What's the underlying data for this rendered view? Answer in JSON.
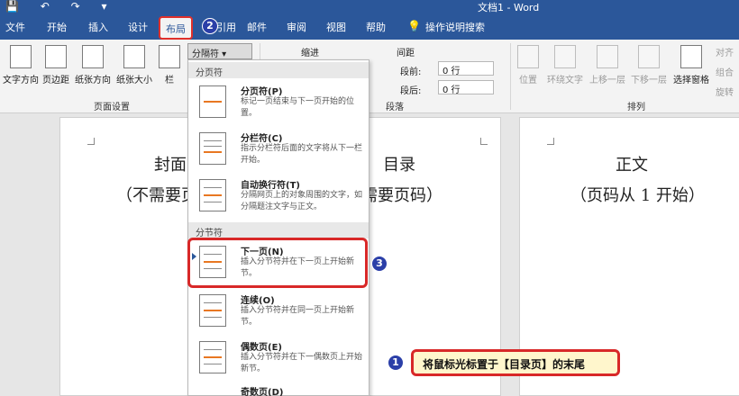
{
  "titlebar": {
    "quick_access": "💾 ↶ ↷ ▾",
    "doc_title": "文档1 - Word"
  },
  "tabs": [
    "文件",
    "开始",
    "插入",
    "设计",
    "布局",
    "引用",
    "邮件",
    "审阅",
    "视图",
    "帮助",
    "操作说明搜索"
  ],
  "ribbon": {
    "buttons": [
      "文字方向",
      "页边距",
      "纸张方向",
      "纸张大小",
      "栏"
    ],
    "breaks_label": "分隔符 ▾",
    "indent_label": "缩进",
    "spacing_label": "间距",
    "before_label": "段前:",
    "after_label": "段后:",
    "before_value": "0 行",
    "after_value": "0 行",
    "arrange_buttons": [
      "位置",
      "环绕文字",
      "上移一层",
      "下移一层",
      "选择窗格"
    ],
    "align_labels": [
      "对齐",
      "组合",
      "旋转"
    ],
    "groups": {
      "page_setup": "页面设置",
      "paragraph": "段落",
      "arrange": "排列"
    }
  },
  "pages": {
    "cover_line1": "封面",
    "cover_line2": "（不需要页",
    "toc_line1": "目录",
    "toc_line2": "需要页码）",
    "body_line1": "正文",
    "body_line2": "（页码从 1 开始）"
  },
  "menu": {
    "page_breaks_header": "分页符",
    "section_breaks_header": "分节符",
    "items": [
      {
        "title": "分页符(P)",
        "desc": "标记一页结束与下一页开始的位置。"
      },
      {
        "title": "分栏符(C)",
        "desc": "指示分栏符后面的文字将从下一栏开始。"
      },
      {
        "title": "自动换行符(T)",
        "desc": "分隔网页上的对象周围的文字，如分隔题注文字与正文。"
      },
      {
        "title": "下一页(N)",
        "desc": "插入分节符并在下一页上开始新节。"
      },
      {
        "title": "连续(O)",
        "desc": "插入分节符并在同一页上开始新节。"
      },
      {
        "title": "偶数页(E)",
        "desc": "插入分节符并在下一偶数页上开始新节。"
      },
      {
        "title": "奇数页(D)",
        "desc": ""
      }
    ]
  },
  "steps": {
    "one": "1",
    "two": "2",
    "three": "3"
  },
  "callout": "将鼠标光标置于【目录页】的末尾",
  "colors": {
    "ribbon_blue": "#2b579a",
    "highlight_red": "#d82828",
    "step_blue": "#2b3fa8",
    "callout_bg": "#fff6cc"
  }
}
